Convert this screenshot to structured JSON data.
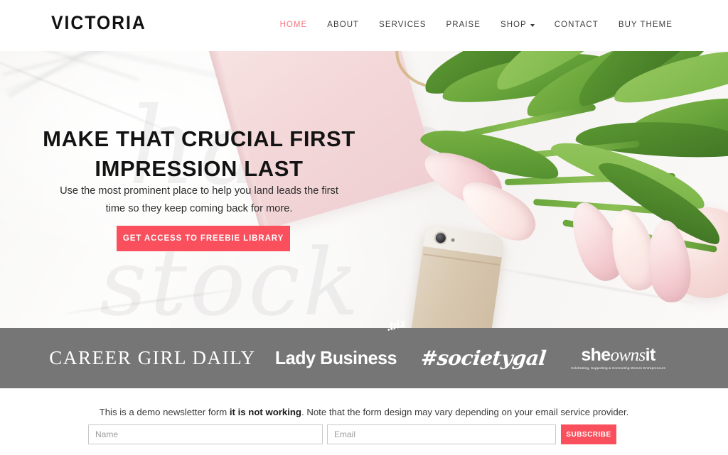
{
  "header": {
    "logo": "VICTORIA",
    "nav": [
      {
        "label": "HOME",
        "active": true,
        "caret": false
      },
      {
        "label": "ABOUT",
        "active": false,
        "caret": false
      },
      {
        "label": "SERVICES",
        "active": false,
        "caret": false
      },
      {
        "label": "PRAISE",
        "active": false,
        "caret": false
      },
      {
        "label": "SHOP",
        "active": false,
        "caret": true
      },
      {
        "label": "CONTACT",
        "active": false,
        "caret": false
      },
      {
        "label": "BUY THEME",
        "active": false,
        "caret": false
      }
    ]
  },
  "hero": {
    "title_line1": "MAKE THAT CRUCIAL FIRST",
    "title_line2": "IMPRESSION LAST",
    "subtitle": "Use the most prominent place to help you land leads the first time so they keep coming back for more.",
    "cta_label": "GET ACCESS TO FREEBIE LIBRARY",
    "cta_color": "#fa4f5c",
    "background_description": "white marble flatlay with pink tulips, gold phone and pink notebook"
  },
  "logo_bar": {
    "background_color": "#767676",
    "brands": [
      {
        "name": "CAREER GIRL DAILY"
      },
      {
        "name": "Lady Business",
        "superscript": ".biz"
      },
      {
        "name": "#societygal"
      },
      {
        "name_part1": "she",
        "name_part2": "owns",
        "name_part3": "it",
        "tagline": "Celebrating, Supporting & Connecting Women Entrepreneurs"
      }
    ]
  },
  "newsletter": {
    "note_prefix": "This is a demo newsletter form ",
    "note_bold": "it is not working",
    "note_suffix": ". Note that the form design may vary depending on your email service provider.",
    "name_placeholder": "Name",
    "name_value": "",
    "email_placeholder": "Email",
    "email_value": "",
    "submit_label": "SUBSCRIBE",
    "submit_color": "#fa4f5c"
  }
}
